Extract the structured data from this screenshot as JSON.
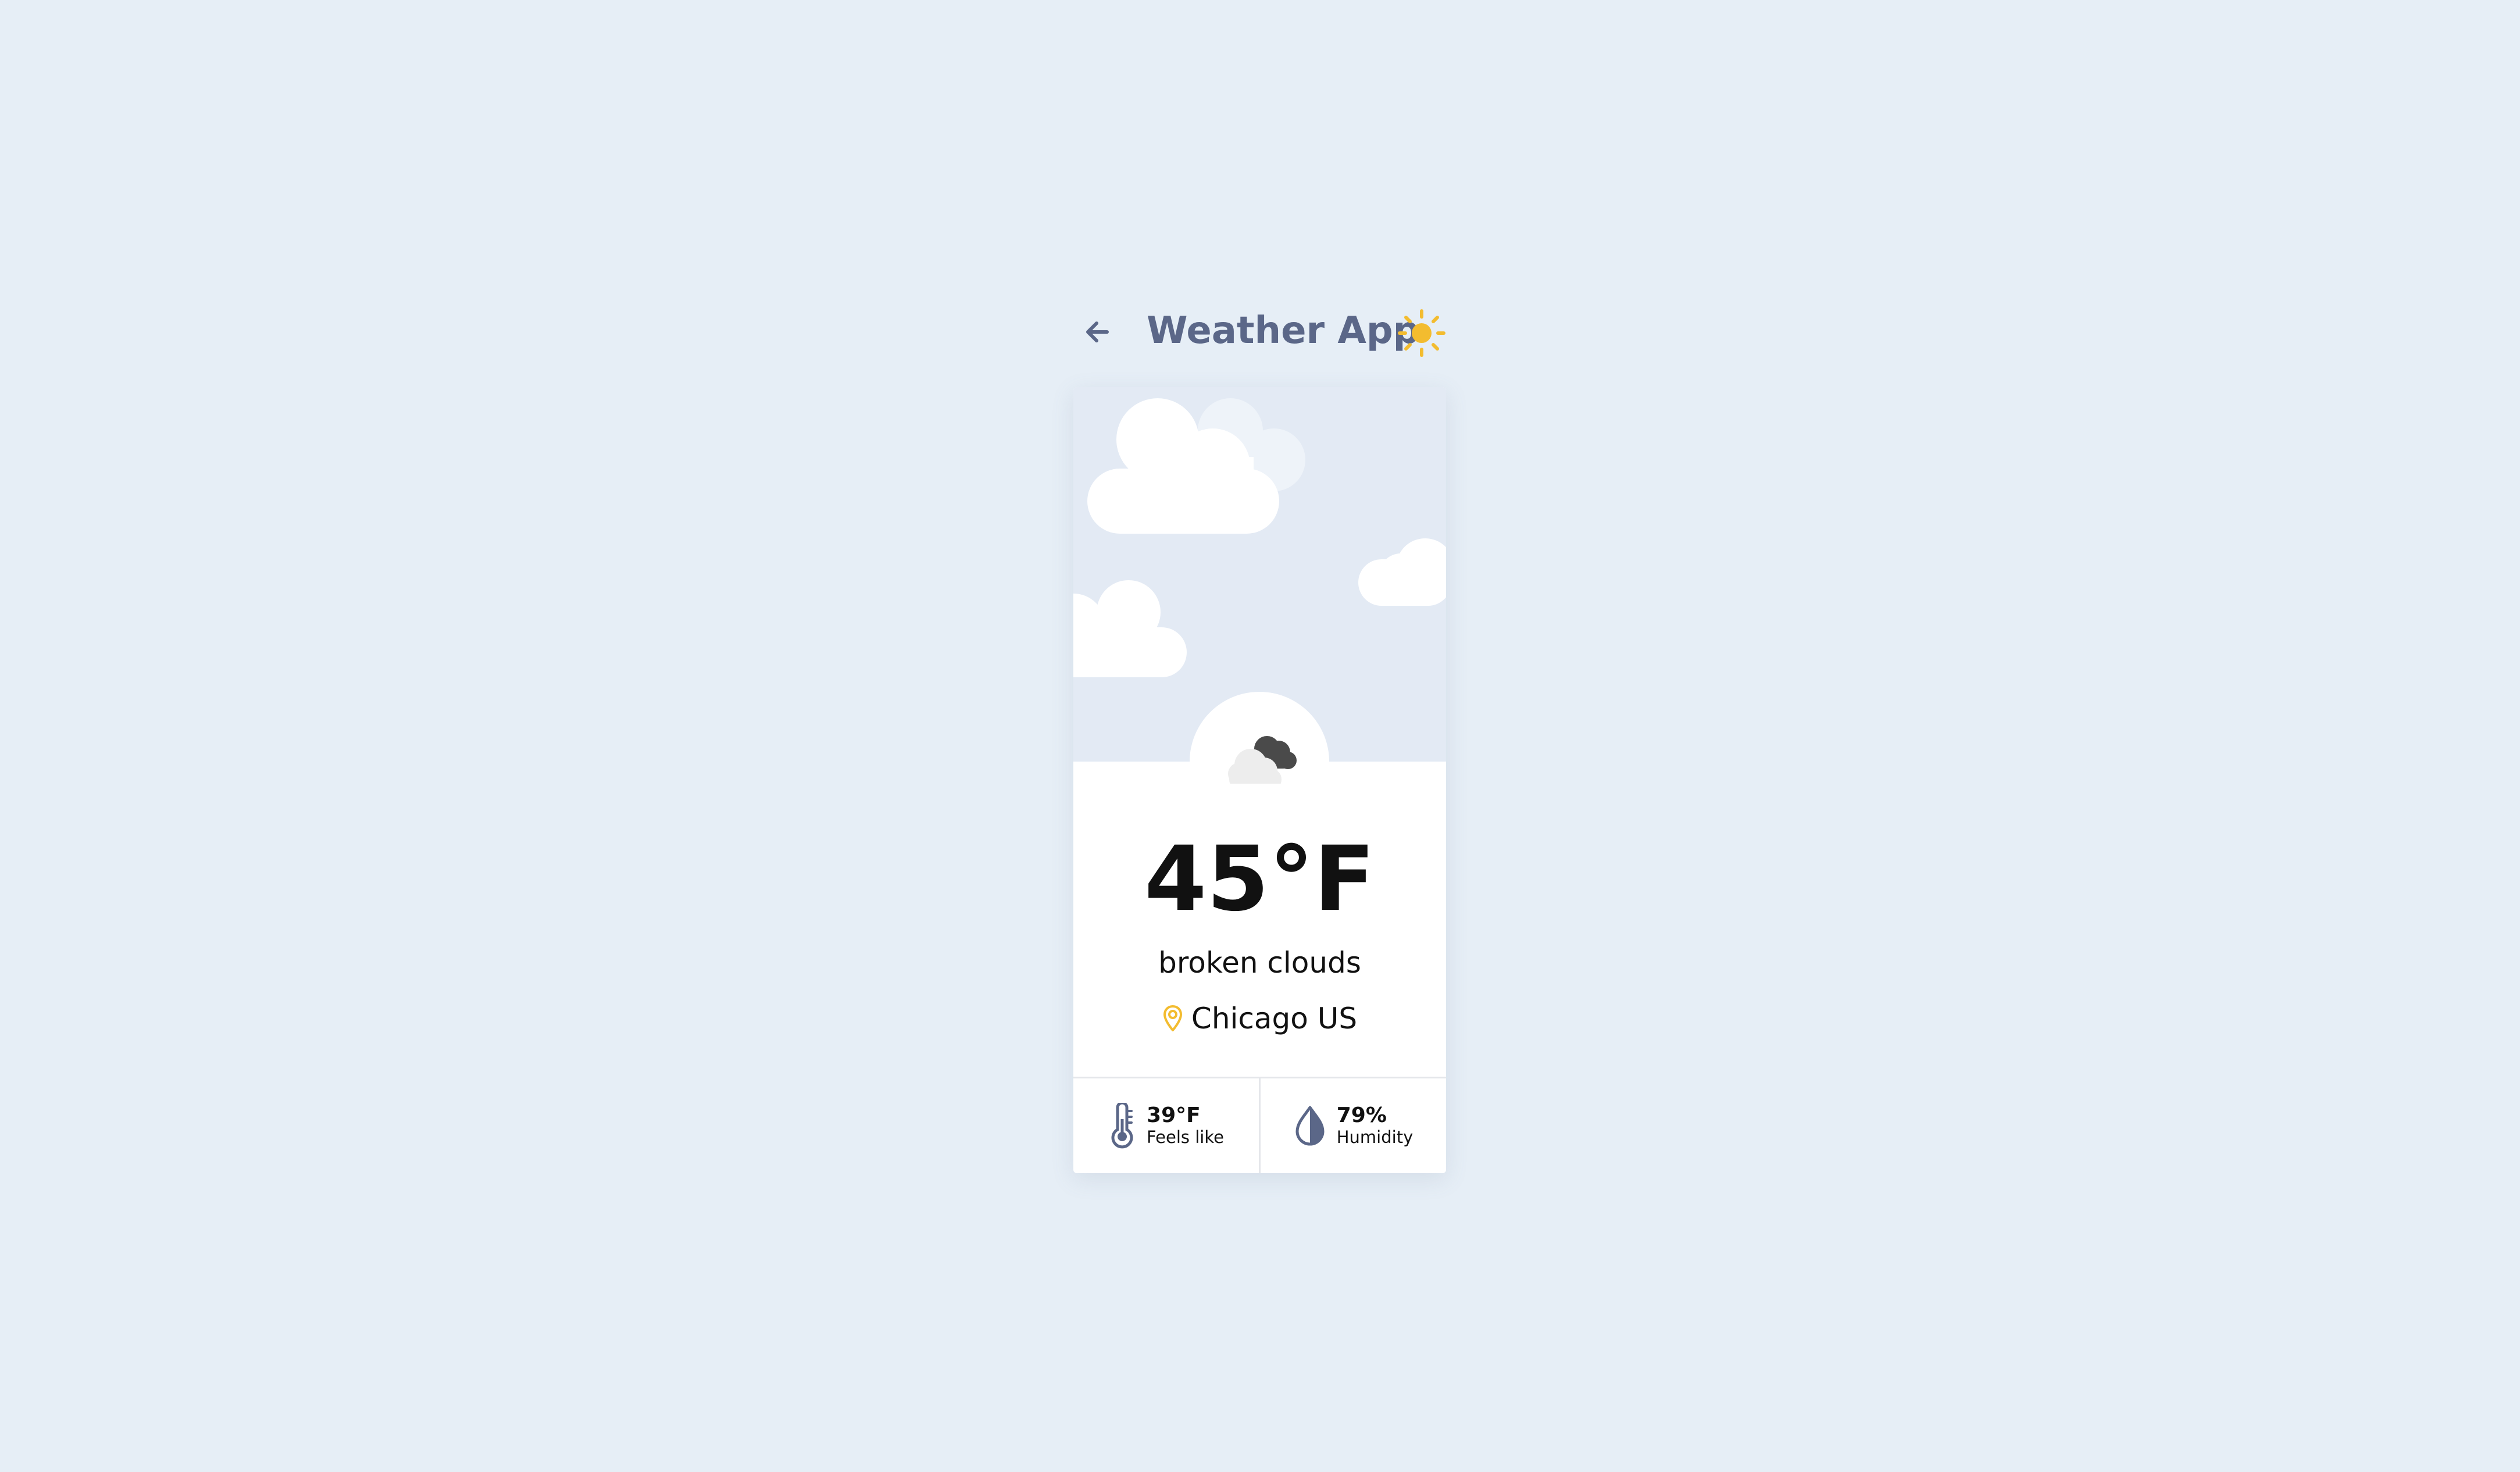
{
  "header": {
    "title": "Weather App",
    "back_icon": "arrow-left-icon",
    "theme_icon": "sun-icon"
  },
  "current": {
    "temperature": "45°F",
    "description": "broken clouds",
    "location": "Chicago US",
    "condition_icon": "broken-clouds-icon",
    "location_icon": "map-pin-icon"
  },
  "stats": {
    "feels_like": {
      "value": "39°F",
      "label": "Feels like",
      "icon": "thermometer-icon"
    },
    "humidity": {
      "value": "79%",
      "label": "Humidity",
      "icon": "water-drop-icon"
    }
  },
  "colors": {
    "page_background": "#e6eef6",
    "sky_background": "#e3eaf4",
    "title": "#5b6788",
    "accent_yellow": "#f3bc2f",
    "card_background": "#ffffff",
    "icon_slate": "#5b6788"
  }
}
